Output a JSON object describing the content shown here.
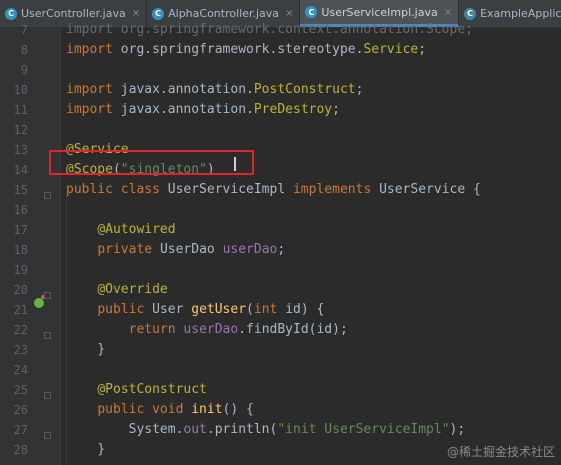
{
  "tabs": [
    {
      "label": "UserController.java",
      "icon": "class-icon",
      "active": false
    },
    {
      "label": "AlphaController.java",
      "icon": "class-icon",
      "active": false
    },
    {
      "label": "UserServiceImpl.java",
      "icon": "class-icon",
      "active": true
    },
    {
      "label": "ExampleApplication.java",
      "icon": "spring-app-icon",
      "active": false
    }
  ],
  "editor": {
    "lines": [
      {
        "num": "7",
        "tokens": [
          [
            "dim",
            "import org.springframework.context.annotation.Scope;"
          ]
        ]
      },
      {
        "num": "8",
        "tokens": [
          [
            "kw",
            "import "
          ],
          [
            "plain",
            "org.springframework.stereotype."
          ],
          [
            "an",
            "Service"
          ],
          [
            "plain",
            ";"
          ]
        ]
      },
      {
        "num": "9",
        "tokens": []
      },
      {
        "num": "10",
        "tokens": [
          [
            "kw",
            "import "
          ],
          [
            "plain",
            "javax.annotation."
          ],
          [
            "an",
            "PostConstruct"
          ],
          [
            "plain",
            ";"
          ]
        ]
      },
      {
        "num": "11",
        "tokens": [
          [
            "kw",
            "import "
          ],
          [
            "plain",
            "javax.annotation."
          ],
          [
            "an",
            "PreDestroy"
          ],
          [
            "plain",
            ";"
          ]
        ]
      },
      {
        "num": "12",
        "tokens": []
      },
      {
        "num": "13",
        "tokens": [
          [
            "an",
            "@Service"
          ]
        ]
      },
      {
        "num": "14",
        "tokens": [
          [
            "an",
            "@Scope"
          ],
          [
            "plain",
            "("
          ],
          [
            "st",
            "\"singleton\""
          ],
          [
            "plain",
            ")"
          ]
        ]
      },
      {
        "num": "15",
        "tokens": [
          [
            "kw",
            "public class "
          ],
          [
            "plain",
            "UserServiceImpl "
          ],
          [
            "kw",
            "implements "
          ],
          [
            "plain",
            "UserService {"
          ]
        ]
      },
      {
        "num": "16",
        "tokens": []
      },
      {
        "num": "17",
        "tokens": [
          [
            "plain",
            "    "
          ],
          [
            "an",
            "@Autowired"
          ]
        ]
      },
      {
        "num": "18",
        "tokens": [
          [
            "plain",
            "    "
          ],
          [
            "kw",
            "private "
          ],
          [
            "plain",
            "UserDao "
          ],
          [
            "fd",
            "userDao"
          ],
          [
            "plain",
            ";"
          ]
        ]
      },
      {
        "num": "19",
        "tokens": []
      },
      {
        "num": "20",
        "tokens": [
          [
            "plain",
            "    "
          ],
          [
            "an",
            "@Override"
          ]
        ]
      },
      {
        "num": "21",
        "tokens": [
          [
            "plain",
            "    "
          ],
          [
            "kw",
            "public "
          ],
          [
            "plain",
            "User "
          ],
          [
            "fn",
            "getUser"
          ],
          [
            "plain",
            "("
          ],
          [
            "kw",
            "int "
          ],
          [
            "plain",
            "id) {"
          ]
        ]
      },
      {
        "num": "22",
        "tokens": [
          [
            "plain",
            "        "
          ],
          [
            "kw",
            "return "
          ],
          [
            "fd",
            "userDao"
          ],
          [
            "plain",
            ".findById(id);"
          ]
        ]
      },
      {
        "num": "23",
        "tokens": [
          [
            "plain",
            "    }"
          ]
        ]
      },
      {
        "num": "24",
        "tokens": []
      },
      {
        "num": "25",
        "tokens": [
          [
            "plain",
            "    "
          ],
          [
            "an",
            "@PostConstruct"
          ]
        ]
      },
      {
        "num": "26",
        "tokens": [
          [
            "plain",
            "    "
          ],
          [
            "kw",
            "public void "
          ],
          [
            "fn",
            "init"
          ],
          [
            "plain",
            "() {"
          ]
        ]
      },
      {
        "num": "27",
        "tokens": [
          [
            "plain",
            "        System."
          ],
          [
            "fd",
            "out"
          ],
          [
            "plain",
            ".println("
          ],
          [
            "st",
            "\"init UserServiceImpl\""
          ],
          [
            "plain",
            ");"
          ]
        ]
      },
      {
        "num": "28",
        "tokens": [
          [
            "plain",
            "    }"
          ]
        ]
      }
    ]
  },
  "watermark": "@稀土掘金技术社区",
  "colors": {
    "highlight_box": "#e0252a",
    "active_tab_underline": "#4a88c7",
    "background": "#2b2b2b"
  }
}
